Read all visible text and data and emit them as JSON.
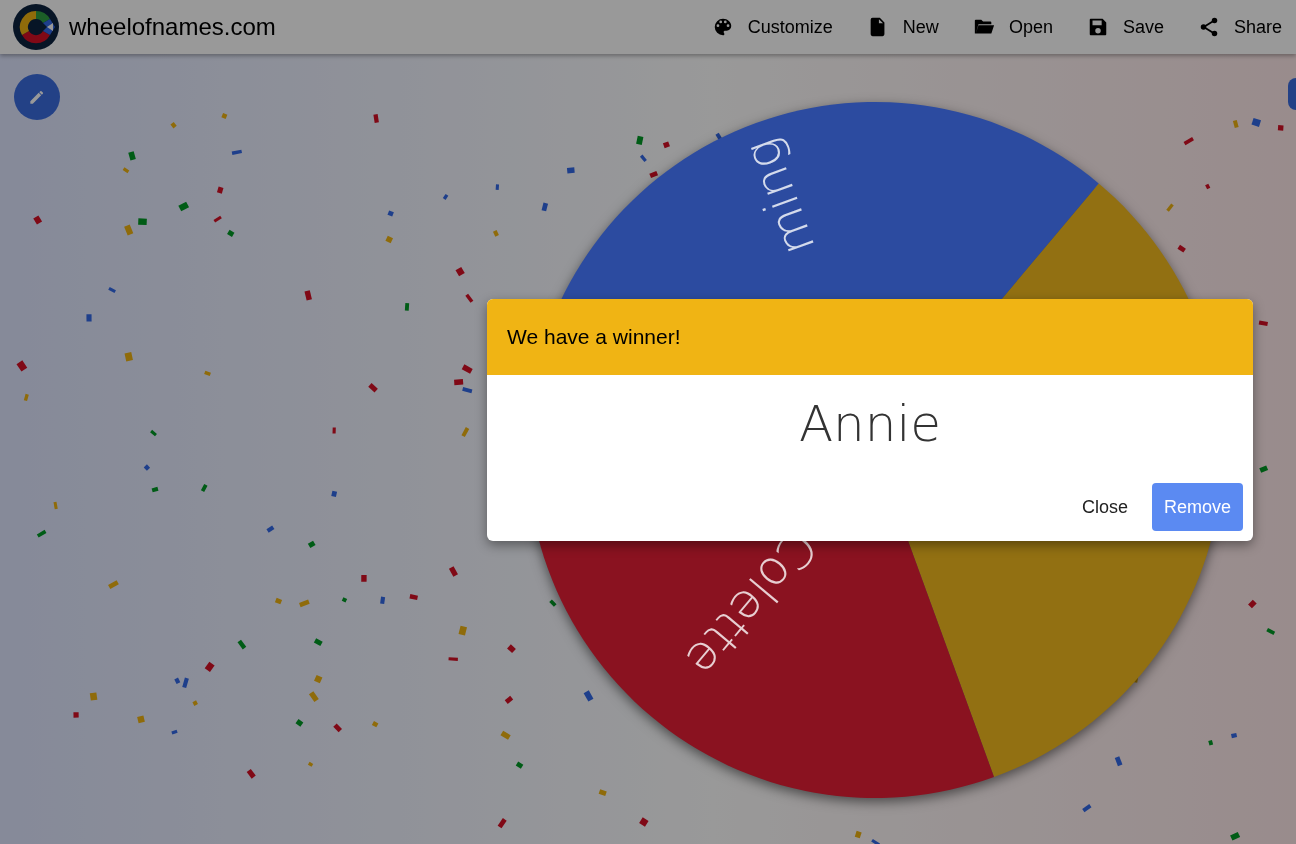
{
  "header": {
    "site_title": "wheelofnames.com",
    "menu": [
      {
        "label": "Customize",
        "kind": "palette"
      },
      {
        "label": "New",
        "kind": "file"
      },
      {
        "label": "Open",
        "kind": "folder"
      },
      {
        "label": "Save",
        "kind": "save"
      },
      {
        "label": "Share",
        "kind": "share"
      }
    ]
  },
  "wheel": {
    "slices": [
      {
        "color": "#927012"
      },
      {
        "label": "Colette",
        "color": "#8a1220"
      },
      {
        "label": "ming",
        "color": "#2c4ba0"
      }
    ]
  },
  "dialog": {
    "title": "We have a winner!",
    "winner": "Annie",
    "buttons": [
      {
        "label": "Close",
        "kind": "text"
      },
      {
        "label": "Remove",
        "kind": "filled"
      }
    ]
  }
}
